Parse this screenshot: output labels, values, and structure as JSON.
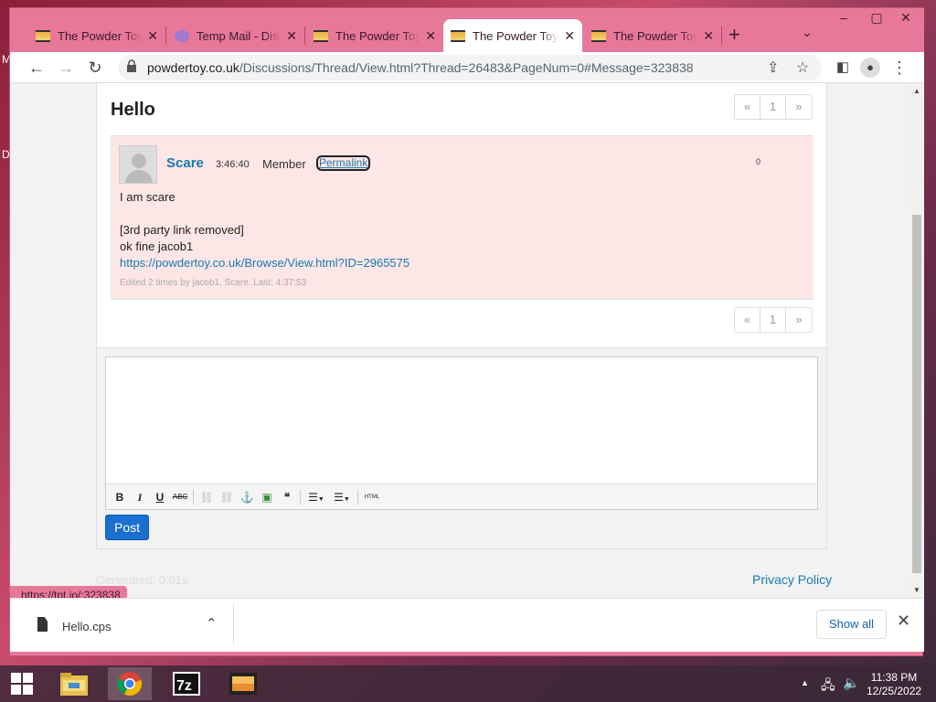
{
  "desktop": {
    "letters": [
      "M",
      "D"
    ]
  },
  "browser": {
    "tabs": [
      {
        "title": "The Powder Toy",
        "icon": "film-icon"
      },
      {
        "title": "Temp Mail - Disposable",
        "icon": "tempmail-icon"
      },
      {
        "title": "The Powder Toy",
        "icon": "film-icon"
      },
      {
        "title": "The Powder Toy",
        "icon": "film-icon",
        "active": true
      },
      {
        "title": "The Powder Toy",
        "icon": "film-icon"
      }
    ],
    "url_host": "powdertoy.co.uk",
    "url_path": "/Discussions/Thread/View.html?Thread=26483&PageNum=0#Message=323838",
    "status_url": "https://tpt.io/:323838"
  },
  "thread": {
    "title": "Hello",
    "pager": {
      "prev": "«",
      "page": "1",
      "next": "»"
    },
    "post": {
      "author": "Scare",
      "time": "3:46:40",
      "role": "Member",
      "permalink": "Permalink",
      "votes": "0",
      "lines": [
        "I am scare",
        "[3rd party link removed]",
        "ok fine jacob1"
      ],
      "link": "https://powdertoy.co.uk/Browse/View.html?ID=2965575",
      "edited": "Edited 2 times by jacob1, Scare. Last: 4:37:53"
    }
  },
  "editor": {
    "toolbar": [
      "B",
      "I",
      "U",
      "ABC",
      "⛓",
      "⛓",
      "⚓",
      "▣",
      "❝",
      "☰",
      "☰",
      "HTML"
    ],
    "post_label": "Post"
  },
  "footer": {
    "generated": "Generated: 0.01s",
    "privacy": "Privacy Policy"
  },
  "downloads": {
    "file": "Hello.cps",
    "show_all": "Show all"
  },
  "taskbar": {
    "time": "11:38 PM",
    "date": "12/25/2022"
  },
  "colors": {
    "accent": "#1a7ab0",
    "post_bg": "#fde6e6",
    "frame": "#e8789a"
  }
}
